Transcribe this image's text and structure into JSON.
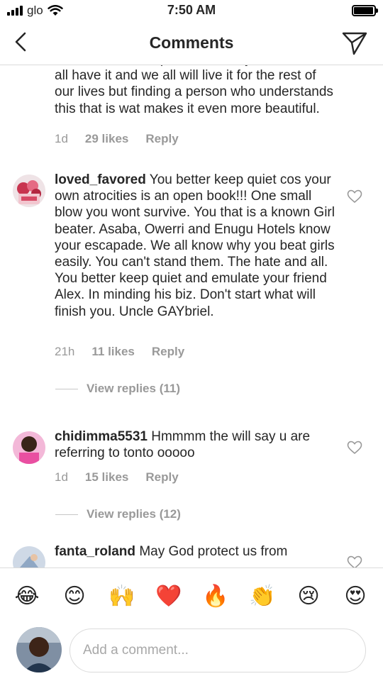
{
  "status_bar": {
    "carrier": "glo",
    "time": "7:50 AM"
  },
  "header": {
    "title": "Comments"
  },
  "comments": [
    {
      "username": "",
      "text": "feel like a terrible person cos of your flaws. We all have it and we all will live it for the rest of our lives but finding a person who understands this that is wat makes it even more beautiful.",
      "age": "1d",
      "likes": "29 likes",
      "reply_label": "Reply"
    },
    {
      "username": "loved_favored",
      "text": "You better keep quiet cos your own atrocities is an open book!!! One small blow you wont survive. You that is a known Girl beater. Asaba, Owerri and Enugu Hotels know your escapade. We all know why you beat girls easily. You can't stand them. The hate and all. You better keep quiet and emulate your friend Alex. In minding his biz. Don't start what will finish you. Uncle GAYbriel.",
      "age": "21h",
      "likes": "11 likes",
      "reply_label": "Reply",
      "view_replies": "View replies (11)"
    },
    {
      "username": "chidimma5531",
      "text": "Hmmmm the will say u are referring to tonto ooooo",
      "age": "1d",
      "likes": "15 likes",
      "reply_label": "Reply",
      "view_replies": "View replies (12)"
    },
    {
      "username": "fanta_roland",
      "text": "May God protect us from"
    }
  ],
  "emojis": [
    "😂",
    "😊",
    "🙌",
    "❤️",
    "🔥",
    "👏",
    "😢",
    "😍"
  ],
  "composer": {
    "placeholder": "Add a comment..."
  }
}
